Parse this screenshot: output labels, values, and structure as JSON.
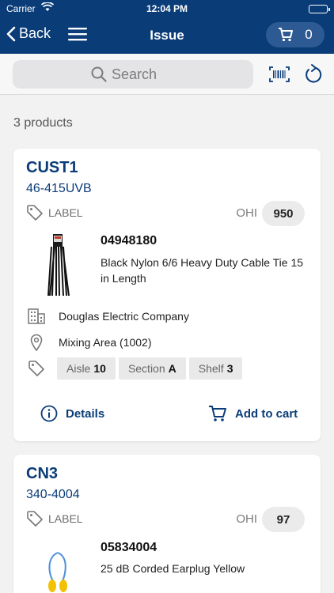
{
  "status_bar": {
    "carrier": "Carrier",
    "time": "12:04 PM",
    "wifi_icon": "wifi-icon",
    "battery_icon": "battery-icon"
  },
  "nav": {
    "back_label": "Back",
    "title": "Issue",
    "cart_count": "0",
    "menu_icon": "hamburger-icon",
    "cart_icon": "cart-icon"
  },
  "search": {
    "placeholder": "Search",
    "scan_icon": "barcode-icon",
    "refresh_icon": "refresh-icon"
  },
  "results_count": "3 products",
  "colors": {
    "brand": "#0a3c78",
    "background": "#f2f2f2"
  },
  "products": [
    {
      "customer": "CUST1",
      "part_number": "46-415UVB",
      "label": "LABEL",
      "ohi_label": "OHI",
      "ohi_value": "950",
      "item_number": "04948180",
      "description": "Black Nylon 6/6 Heavy Duty Cable Tie 15 in Length",
      "vendor": "Douglas Electric Company",
      "location": "Mixing Area (1002)",
      "aisle_label": "Aisle",
      "aisle_value": "10",
      "section_label": "Section",
      "section_value": "A",
      "shelf_label": "Shelf",
      "shelf_value": "3",
      "details_label": "Details",
      "add_to_cart_label": "Add to cart"
    },
    {
      "customer": "CN3",
      "part_number": "340-4004",
      "label": "LABEL",
      "ohi_label": "OHI",
      "ohi_value": "97",
      "item_number": "05834004",
      "description": "25 dB Corded Earplug Yellow"
    }
  ]
}
